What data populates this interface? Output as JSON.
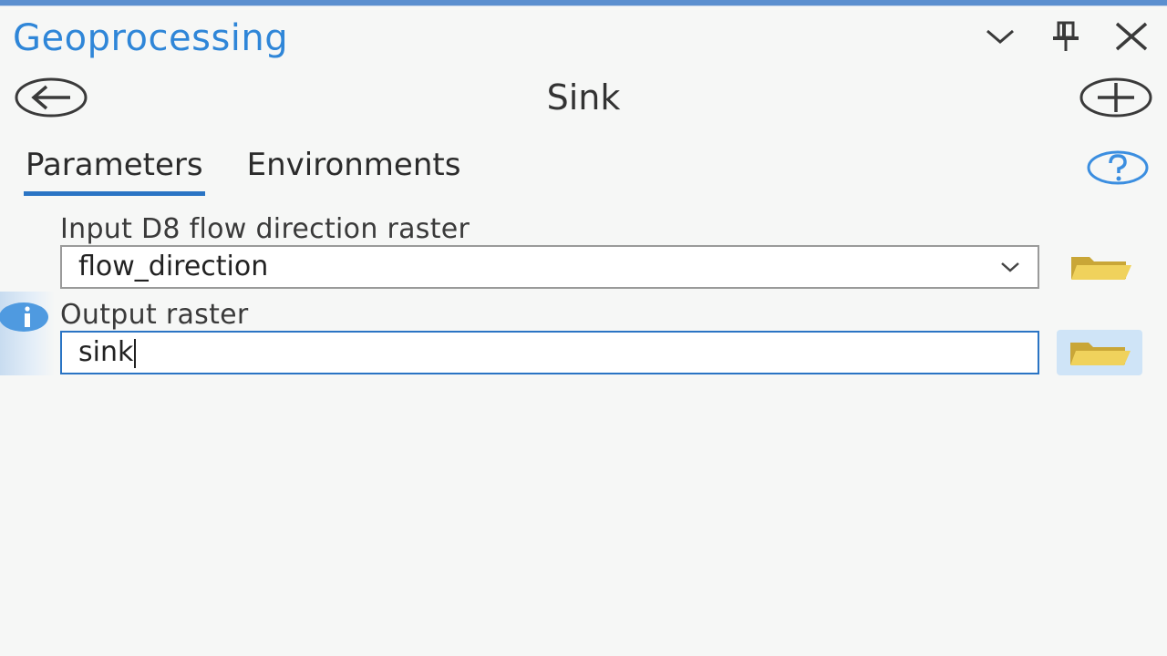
{
  "pane": {
    "title": "Geoprocessing",
    "controls": {
      "options_icon": "chevron-down-icon",
      "pin_icon": "pin-icon",
      "close_icon": "close-icon"
    }
  },
  "tool": {
    "name": "Sink",
    "back_icon": "back-arrow-icon",
    "add_icon": "add-icon"
  },
  "tabs": [
    {
      "label": "Parameters",
      "active": true
    },
    {
      "label": "Environments",
      "active": false
    }
  ],
  "help_icon": "help-icon",
  "parameters": [
    {
      "label": "Input D8 flow direction raster",
      "value": "flow_direction",
      "type": "dropdown",
      "browse_icon": "folder-icon"
    },
    {
      "label": "Output raster",
      "value": "sink",
      "type": "text",
      "focused": true,
      "info_icon": "info-icon",
      "browse_icon": "folder-icon"
    }
  ],
  "colors": {
    "accent": "#2a74c4",
    "title": "#2f86d8",
    "folder": "#e8c54a",
    "background": "#f6f7f6"
  }
}
